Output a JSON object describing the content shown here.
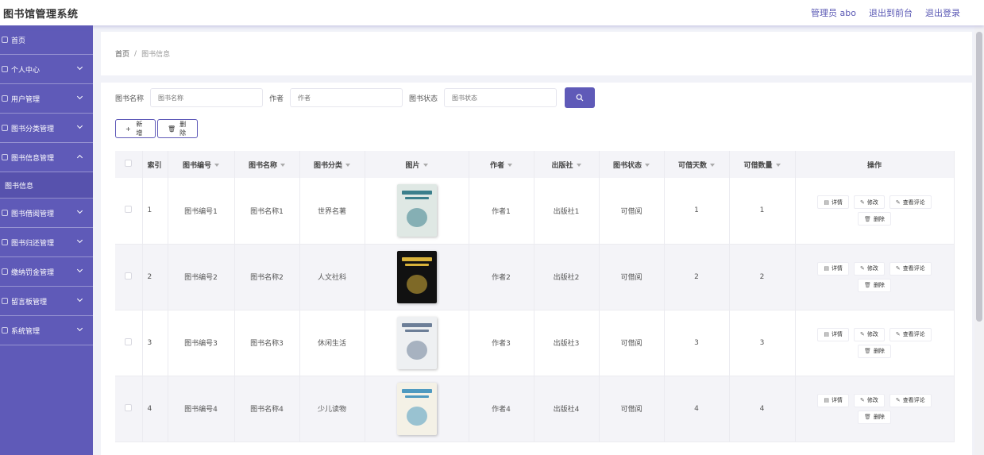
{
  "header": {
    "title": "图书馆管理系统",
    "user_label": "管理员 abo",
    "front_link": "退出到前台",
    "logout_link": "退出登录"
  },
  "sidebar": {
    "items": [
      {
        "label": "首页",
        "icon": "home-icon",
        "chevron": "none"
      },
      {
        "label": "个人中心",
        "icon": "user-icon",
        "chevron": "down"
      },
      {
        "label": "用户管理",
        "icon": "users-icon",
        "chevron": "down"
      },
      {
        "label": "图书分类管理",
        "icon": "category-icon",
        "chevron": "down"
      },
      {
        "label": "图书信息管理",
        "icon": "book-icon",
        "chevron": "up"
      },
      {
        "label": "图书信息",
        "sub": true
      },
      {
        "label": "图书借阅管理",
        "icon": "borrow-icon",
        "chevron": "down"
      },
      {
        "label": "图书归还管理",
        "icon": "return-icon",
        "chevron": "down"
      },
      {
        "label": "缴纳罚金管理",
        "icon": "fine-icon",
        "chevron": "down"
      },
      {
        "label": "留言板管理",
        "icon": "message-icon",
        "chevron": "down"
      },
      {
        "label": "系统管理",
        "icon": "settings-icon",
        "chevron": "down"
      }
    ]
  },
  "breadcrumb": {
    "home": "首页",
    "separator": "/",
    "current": "图书信息"
  },
  "search": {
    "name_label": "图书名称",
    "name_placeholder": "图书名称",
    "author_label": "作者",
    "author_placeholder": "作者",
    "status_label": "图书状态",
    "status_placeholder": "图书状态",
    "button_icon": "search-icon"
  },
  "actions": {
    "add_label": "新增",
    "delete_label": "删除"
  },
  "table": {
    "columns": [
      "索引",
      "图书编号",
      "图书名称",
      "图书分类",
      "图片",
      "作者",
      "出版社",
      "图书状态",
      "可借天数",
      "可借数量",
      "操作"
    ],
    "rows": [
      {
        "index": "1",
        "code": "图书编号1",
        "name": "图书名称1",
        "category": "世界名著",
        "author": "作者1",
        "publisher": "出版社1",
        "status": "可借阅",
        "days": "1",
        "qty": "1",
        "cover": "#dfe8e4",
        "accent": "#3b7f8c"
      },
      {
        "index": "2",
        "code": "图书编号2",
        "name": "图书名称2",
        "category": "人文社科",
        "author": "作者2",
        "publisher": "出版社2",
        "status": "可借阅",
        "days": "2",
        "qty": "2",
        "cover": "#111111",
        "accent": "#d8b23a"
      },
      {
        "index": "3",
        "code": "图书编号3",
        "name": "图书名称3",
        "category": "休闲生活",
        "author": "作者3",
        "publisher": "出版社3",
        "status": "可借阅",
        "days": "3",
        "qty": "3",
        "cover": "#eef0f2",
        "accent": "#6d7f98"
      },
      {
        "index": "4",
        "code": "图书编号4",
        "name": "图书名称4",
        "category": "少儿读物",
        "author": "作者4",
        "publisher": "出版社4",
        "status": "可借阅",
        "days": "4",
        "qty": "4",
        "cover": "#f4f1e6",
        "accent": "#4f9ac0"
      }
    ],
    "ops": {
      "detail": "详情",
      "edit": "修改",
      "comments": "查看评论",
      "delete": "删除"
    }
  },
  "colors": {
    "primary": "#5f5ab8",
    "sidebar": "#5f5ab8",
    "background": "#f1f2f8"
  }
}
